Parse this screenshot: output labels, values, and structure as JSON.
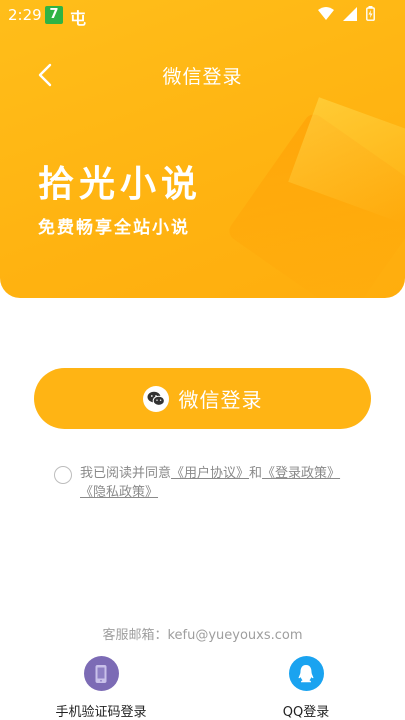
{
  "status_bar": {
    "time": "2:29",
    "badge": "7",
    "app_glyph": "屯",
    "icons": [
      "wifi-icon",
      "signal-icon",
      "battery-icon"
    ]
  },
  "header": {
    "back_icon": "chevron-left-icon",
    "title": "微信登录"
  },
  "hero": {
    "app_name": "拾光小说",
    "tagline": "免费畅享全站小说"
  },
  "wechat_login": {
    "icon": "wechat-icon",
    "label": "微信登录"
  },
  "agreement": {
    "prefix": "我已阅读并同意",
    "user_agreement": "《用户协议》",
    "conjunction": "和",
    "login_policy": "《登录政策》",
    "privacy_policy": "《隐私政策》"
  },
  "footer": {
    "service_email": "客服邮箱：kefu@yueyouxs.com",
    "phone_login": {
      "label": "手机验证码登录",
      "icon": "phone-icon"
    },
    "qq_login": {
      "label": "QQ登录",
      "icon": "qq-icon"
    }
  },
  "colors": {
    "brand": "#FFB414",
    "phone_icon_bg": "#7C6BB5",
    "qq_icon_bg": "#1AA3F0"
  }
}
